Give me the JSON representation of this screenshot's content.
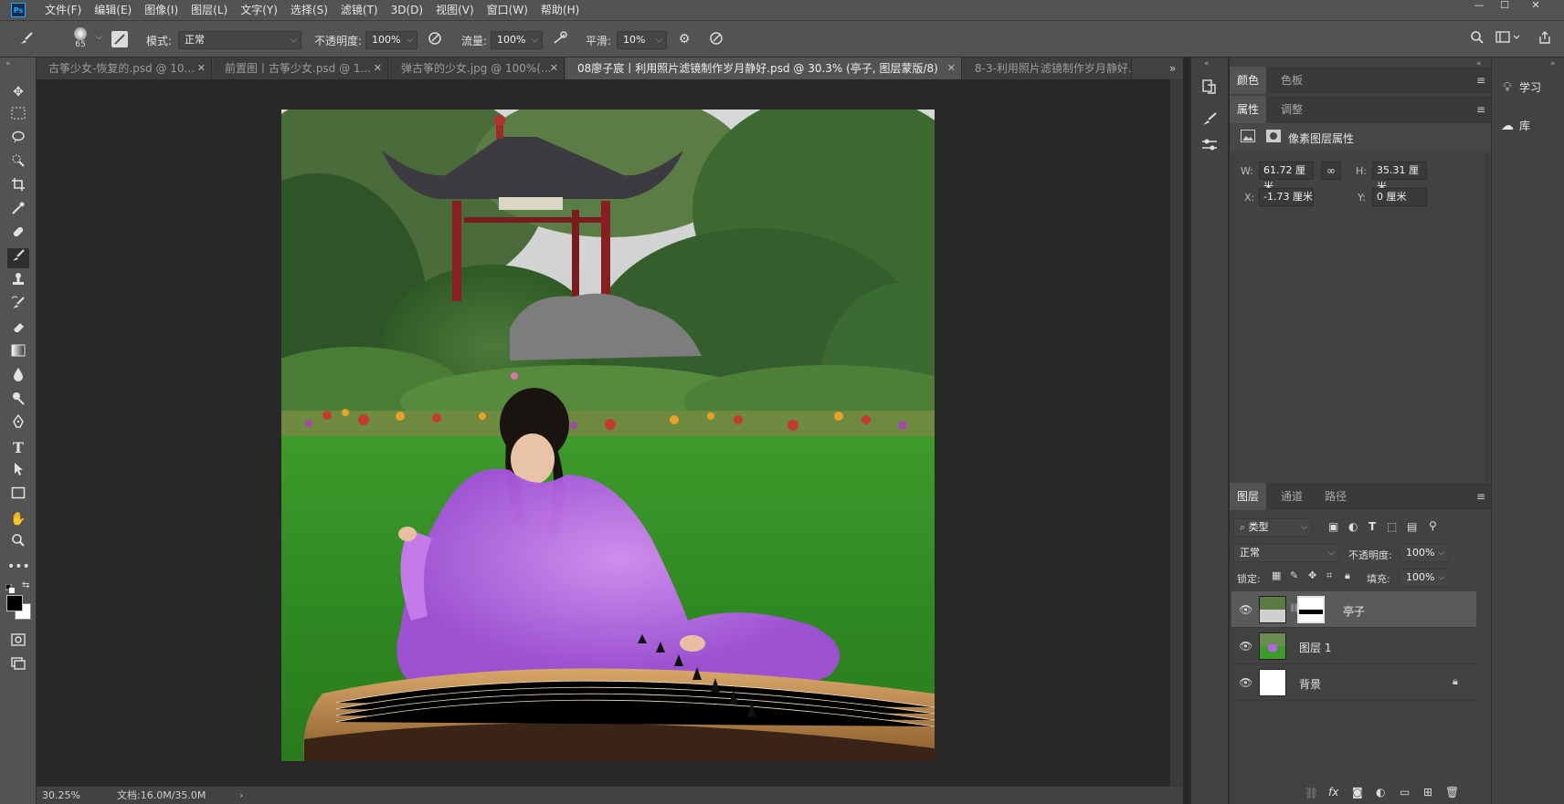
{
  "app": {
    "logo_text": "Ps"
  },
  "menu": [
    "文件(F)",
    "编辑(E)",
    "图像(I)",
    "图层(L)",
    "文字(Y)",
    "选择(S)",
    "滤镜(T)",
    "3D(D)",
    "视图(V)",
    "窗口(W)",
    "帮助(H)"
  ],
  "options": {
    "brush_size": "65",
    "mode_label": "模式:",
    "mode_value": "正常",
    "opacity_label": "不透明度:",
    "opacity_value": "100%",
    "flow_label": "流量:",
    "flow_value": "100%",
    "smoothing_label": "平滑:",
    "smoothing_value": "10%"
  },
  "tabs": [
    {
      "label": "古筝少女-恢复的.psd @ 10..."
    },
    {
      "label": "前置图丨古筝少女.psd @ 1..."
    },
    {
      "label": "弹古筝的少女.jpg @ 100%(..."
    },
    {
      "label": "08廖子宸丨利用照片滤镜制作岁月静好.psd @ 30.3% (亭子, 图层蒙版/8)"
    },
    {
      "label": "8-3-利用照片滤镜制作岁月静好.jp"
    }
  ],
  "status": {
    "zoom": "30.25%",
    "doc": "文档:16.0M/35.0M"
  },
  "panels": {
    "color_tabs": [
      "颜色",
      "色板"
    ],
    "props_tabs": [
      "属性",
      "调整"
    ],
    "props_title": "像素图层属性",
    "w_label": "W:",
    "w_value": "61.72 厘米",
    "h_label": "H:",
    "h_value": "35.31 厘米",
    "x_label": "X:",
    "x_value": "-1.73 厘米",
    "y_label": "Y:",
    "y_value": "0 厘米",
    "layers_tabs": [
      "图层",
      "通道",
      "路径"
    ],
    "filter_value": "类型",
    "blend_value": "正常",
    "opacity_label": "不透明度:",
    "opacity_value": "100%",
    "lock_label": "锁定:",
    "fill_label": "填充:",
    "fill_value": "100%",
    "layers": [
      {
        "name": "亭子"
      },
      {
        "name": "图层 1"
      },
      {
        "name": "背景"
      }
    ]
  },
  "rightcol": {
    "learn": "学习",
    "library": "库"
  },
  "colors": {
    "accent": "#31a8ff",
    "ui_bg": "#535353",
    "panel_bg": "#424242",
    "canvas_bg": "#282828"
  }
}
